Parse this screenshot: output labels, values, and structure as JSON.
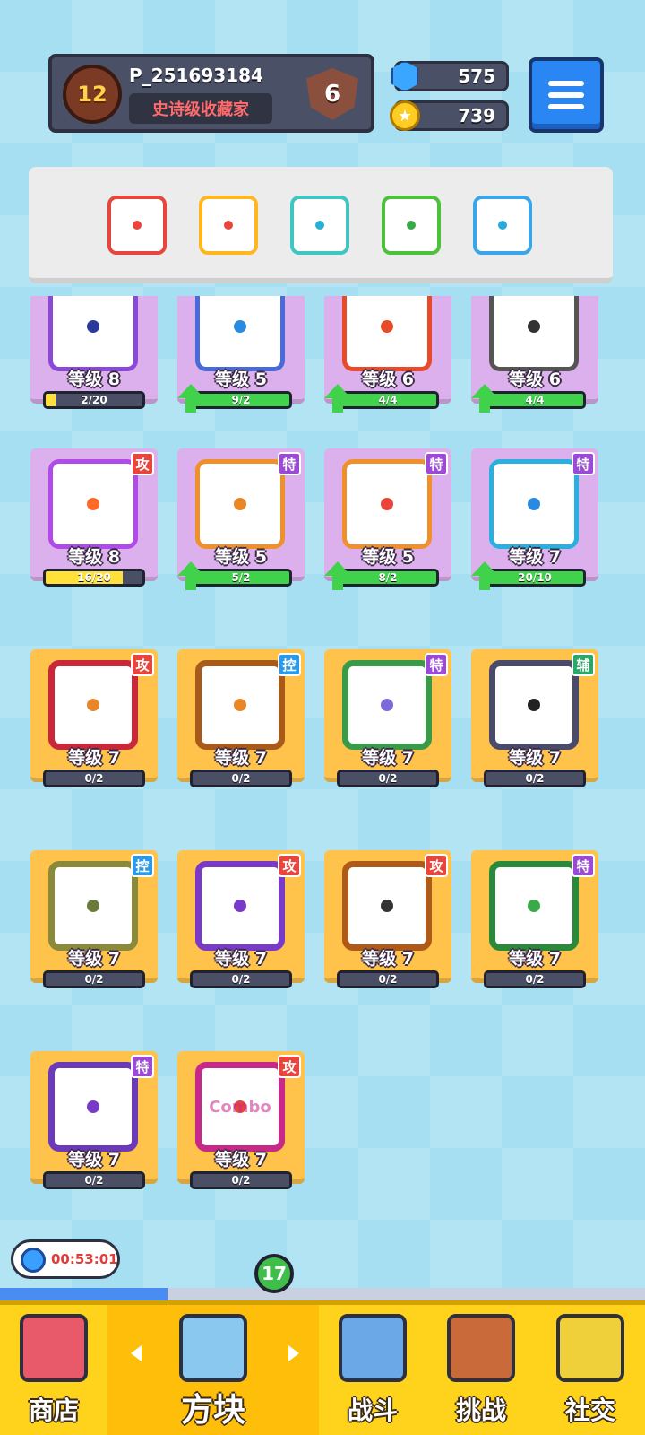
{
  "header": {
    "player_level": "12",
    "player_name": "P_251693184",
    "player_title": "史诗级收藏家",
    "rank": "6",
    "gems": "575",
    "coins": "739"
  },
  "deck": [
    {
      "color": "#e8453c",
      "pip": "#e8453c"
    },
    {
      "color": "#ffb71f",
      "pip": "#e8453c"
    },
    {
      "color": "#3fc6c0",
      "pip": "#2ab0d0"
    },
    {
      "color": "#4cc23a",
      "pip": "#3aa94a"
    },
    {
      "color": "#3aa6e8",
      "pip": "#2aaad8"
    }
  ],
  "cards": [
    {
      "level": "等级 8",
      "progress": "2/20",
      "fill": 0.1,
      "fill_color": "#ffe13a",
      "upgrade": false,
      "rarity": "epic",
      "border": "#8a4ad6",
      "pip": "#2a3a9a",
      "tag": ""
    },
    {
      "level": "等级 5",
      "progress": "9/2",
      "fill": 1,
      "fill_color": "#3fd24a",
      "upgrade": true,
      "rarity": "epic",
      "border": "#4a6ad8",
      "pip": "#2a8ae0",
      "tag": ""
    },
    {
      "level": "等级 6",
      "progress": "4/4",
      "fill": 1,
      "fill_color": "#3fd24a",
      "upgrade": true,
      "rarity": "epic",
      "border": "#e84a2a",
      "pip": "#e84a2a",
      "tag": ""
    },
    {
      "level": "等级 6",
      "progress": "4/4",
      "fill": 1,
      "fill_color": "#3fd24a",
      "upgrade": true,
      "rarity": "epic",
      "border": "#555555",
      "pip": "#333333",
      "tag": ""
    },
    {
      "level": "等级 8",
      "progress": "16/20",
      "fill": 0.8,
      "fill_color": "#ffe13a",
      "upgrade": false,
      "rarity": "epic",
      "border": "#b04ae8",
      "pip": "#ff6a2a",
      "tag": "攻",
      "tag_color": "#e8453c"
    },
    {
      "level": "等级 5",
      "progress": "5/2",
      "fill": 1,
      "fill_color": "#3fd24a",
      "upgrade": true,
      "rarity": "epic",
      "border": "#f0902a",
      "pip": "#e8862a",
      "tag": "特",
      "tag_color": "#9a4ad6"
    },
    {
      "level": "等级 5",
      "progress": "8/2",
      "fill": 1,
      "fill_color": "#3fd24a",
      "upgrade": true,
      "rarity": "epic",
      "border": "#f0902a",
      "pip": "#e8453c",
      "tag": "特",
      "tag_color": "#9a4ad6"
    },
    {
      "level": "等级 7",
      "progress": "20/10",
      "fill": 1,
      "fill_color": "#3fd24a",
      "upgrade": true,
      "rarity": "epic",
      "border": "#2ab0e0",
      "pip": "#2a8ae0",
      "tag": "特",
      "tag_color": "#9a4ad6"
    },
    {
      "level": "等级 7",
      "progress": "0/2",
      "fill": 0,
      "fill_color": "#3fd24a",
      "upgrade": false,
      "rarity": "legend",
      "border": "#c8283a",
      "pip": "#e8862a",
      "tag": "攻",
      "tag_color": "#e8453c"
    },
    {
      "level": "等级 7",
      "progress": "0/2",
      "fill": 0,
      "fill_color": "#3fd24a",
      "upgrade": false,
      "rarity": "legend",
      "border": "#a85a1a",
      "pip": "#e8862a",
      "tag": "控",
      "tag_color": "#2a9ae8"
    },
    {
      "level": "等级 7",
      "progress": "0/2",
      "fill": 0,
      "fill_color": "#3fd24a",
      "upgrade": false,
      "rarity": "legend",
      "border": "#3a9a4a",
      "pip": "#7a6ad8",
      "tag": "特",
      "tag_color": "#9a4ad6"
    },
    {
      "level": "等级 7",
      "progress": "0/2",
      "fill": 0,
      "fill_color": "#3fd24a",
      "upgrade": false,
      "rarity": "legend",
      "border": "#4a4a6a",
      "pip": "#222222",
      "tag": "辅",
      "tag_color": "#2aa86a"
    },
    {
      "level": "等级 7",
      "progress": "0/2",
      "fill": 0,
      "fill_color": "#3fd24a",
      "upgrade": false,
      "rarity": "legend",
      "border": "#8a8a3a",
      "pip": "#6a7a3a",
      "tag": "控",
      "tag_color": "#2a9ae8"
    },
    {
      "level": "等级 7",
      "progress": "0/2",
      "fill": 0,
      "fill_color": "#3fd24a",
      "upgrade": false,
      "rarity": "legend",
      "border": "#7a3ac8",
      "pip": "#7a3ac8",
      "tag": "攻",
      "tag_color": "#e8453c"
    },
    {
      "level": "等级 7",
      "progress": "0/2",
      "fill": 0,
      "fill_color": "#3fd24a",
      "upgrade": false,
      "rarity": "legend",
      "border": "#b05a1a",
      "pip": "#333333",
      "tag": "攻",
      "tag_color": "#e8453c"
    },
    {
      "level": "等级 7",
      "progress": "0/2",
      "fill": 0,
      "fill_color": "#3fd24a",
      "upgrade": false,
      "rarity": "legend",
      "border": "#2a8a3a",
      "pip": "#3aa94a",
      "tag": "特",
      "tag_color": "#9a4ad6"
    },
    {
      "level": "等级 7",
      "progress": "0/2",
      "fill": 0,
      "fill_color": "#3fd24a",
      "upgrade": false,
      "rarity": "legend",
      "border": "#6a3ab8",
      "pip": "#7a3ac8",
      "tag": "特",
      "tag_color": "#9a4ad6"
    },
    {
      "level": "等级 7",
      "progress": "0/2",
      "fill": 0,
      "fill_color": "#3fd24a",
      "upgrade": false,
      "rarity": "legend",
      "border": "#c8288a",
      "pip": "#e8453c",
      "tag": "攻",
      "tag_color": "#e8453c",
      "glyph": "Combo"
    }
  ],
  "timer": "00:53:01",
  "cube_badge": "17",
  "nav": [
    {
      "label": "商店",
      "icon": "shop-icon",
      "color": "#e85a6a"
    },
    {
      "label": "方块",
      "icon": "cube-icon",
      "color": "#8ac8f0",
      "active": true
    },
    {
      "label": "战斗",
      "icon": "battle-icon",
      "color": "#6aa8e8"
    },
    {
      "label": "挑战",
      "icon": "challenge-icon",
      "color": "#c86a3a"
    },
    {
      "label": "社交",
      "icon": "social-icon",
      "color": "#f0d03a"
    }
  ]
}
